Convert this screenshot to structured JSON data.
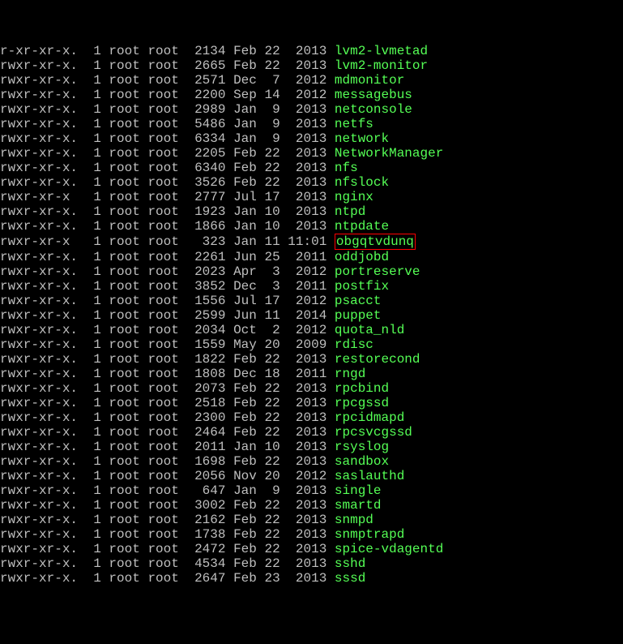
{
  "rows": [
    {
      "perms": "r-xr-xr-x.",
      "links": "1",
      "owner": "root",
      "group": "root",
      "size": "2134",
      "month": "Feb",
      "day": "22",
      "year": "2013",
      "name": "lvm2-lvmetad",
      "hl": false
    },
    {
      "perms": "rwxr-xr-x.",
      "links": "1",
      "owner": "root",
      "group": "root",
      "size": "2665",
      "month": "Feb",
      "day": "22",
      "year": "2013",
      "name": "lvm2-monitor",
      "hl": false
    },
    {
      "perms": "rwxr-xr-x.",
      "links": "1",
      "owner": "root",
      "group": "root",
      "size": "2571",
      "month": "Dec",
      "day": "7",
      "year": "2012",
      "name": "mdmonitor",
      "hl": false
    },
    {
      "perms": "rwxr-xr-x.",
      "links": "1",
      "owner": "root",
      "group": "root",
      "size": "2200",
      "month": "Sep",
      "day": "14",
      "year": "2012",
      "name": "messagebus",
      "hl": false
    },
    {
      "perms": "rwxr-xr-x.",
      "links": "1",
      "owner": "root",
      "group": "root",
      "size": "2989",
      "month": "Jan",
      "day": "9",
      "year": "2013",
      "name": "netconsole",
      "hl": false
    },
    {
      "perms": "rwxr-xr-x.",
      "links": "1",
      "owner": "root",
      "group": "root",
      "size": "5486",
      "month": "Jan",
      "day": "9",
      "year": "2013",
      "name": "netfs",
      "hl": false
    },
    {
      "perms": "rwxr-xr-x.",
      "links": "1",
      "owner": "root",
      "group": "root",
      "size": "6334",
      "month": "Jan",
      "day": "9",
      "year": "2013",
      "name": "network",
      "hl": false
    },
    {
      "perms": "rwxr-xr-x.",
      "links": "1",
      "owner": "root",
      "group": "root",
      "size": "2205",
      "month": "Feb",
      "day": "22",
      "year": "2013",
      "name": "NetworkManager",
      "hl": false
    },
    {
      "perms": "rwxr-xr-x.",
      "links": "1",
      "owner": "root",
      "group": "root",
      "size": "6340",
      "month": "Feb",
      "day": "22",
      "year": "2013",
      "name": "nfs",
      "hl": false
    },
    {
      "perms": "rwxr-xr-x.",
      "links": "1",
      "owner": "root",
      "group": "root",
      "size": "3526",
      "month": "Feb",
      "day": "22",
      "year": "2013",
      "name": "nfslock",
      "hl": false
    },
    {
      "perms": "rwxr-xr-x",
      "links": "1",
      "owner": "root",
      "group": "root",
      "size": "2777",
      "month": "Jul",
      "day": "17",
      "year": "2013",
      "name": "nginx",
      "hl": false
    },
    {
      "perms": "rwxr-xr-x.",
      "links": "1",
      "owner": "root",
      "group": "root",
      "size": "1923",
      "month": "Jan",
      "day": "10",
      "year": "2013",
      "name": "ntpd",
      "hl": false
    },
    {
      "perms": "rwxr-xr-x.",
      "links": "1",
      "owner": "root",
      "group": "root",
      "size": "1866",
      "month": "Jan",
      "day": "10",
      "year": "2013",
      "name": "ntpdate",
      "hl": false
    },
    {
      "perms": "rwxr-xr-x",
      "links": "1",
      "owner": "root",
      "group": "root",
      "size": "323",
      "month": "Jan",
      "day": "11",
      "year": "11:01",
      "name": "obgqtvdunq",
      "hl": true
    },
    {
      "perms": "rwxr-xr-x.",
      "links": "1",
      "owner": "root",
      "group": "root",
      "size": "2261",
      "month": "Jun",
      "day": "25",
      "year": "2011",
      "name": "oddjobd",
      "hl": false
    },
    {
      "perms": "rwxr-xr-x.",
      "links": "1",
      "owner": "root",
      "group": "root",
      "size": "2023",
      "month": "Apr",
      "day": "3",
      "year": "2012",
      "name": "portreserve",
      "hl": false
    },
    {
      "perms": "rwxr-xr-x.",
      "links": "1",
      "owner": "root",
      "group": "root",
      "size": "3852",
      "month": "Dec",
      "day": "3",
      "year": "2011",
      "name": "postfix",
      "hl": false
    },
    {
      "perms": "rwxr-xr-x.",
      "links": "1",
      "owner": "root",
      "group": "root",
      "size": "1556",
      "month": "Jul",
      "day": "17",
      "year": "2012",
      "name": "psacct",
      "hl": false
    },
    {
      "perms": "rwxr-xr-x.",
      "links": "1",
      "owner": "root",
      "group": "root",
      "size": "2599",
      "month": "Jun",
      "day": "11",
      "year": "2014",
      "name": "puppet",
      "hl": false
    },
    {
      "perms": "rwxr-xr-x.",
      "links": "1",
      "owner": "root",
      "group": "root",
      "size": "2034",
      "month": "Oct",
      "day": "2",
      "year": "2012",
      "name": "quota_nld",
      "hl": false
    },
    {
      "perms": "rwxr-xr-x.",
      "links": "1",
      "owner": "root",
      "group": "root",
      "size": "1559",
      "month": "May",
      "day": "20",
      "year": "2009",
      "name": "rdisc",
      "hl": false
    },
    {
      "perms": "rwxr-xr-x.",
      "links": "1",
      "owner": "root",
      "group": "root",
      "size": "1822",
      "month": "Feb",
      "day": "22",
      "year": "2013",
      "name": "restorecond",
      "hl": false
    },
    {
      "perms": "rwxr-xr-x.",
      "links": "1",
      "owner": "root",
      "group": "root",
      "size": "1808",
      "month": "Dec",
      "day": "18",
      "year": "2011",
      "name": "rngd",
      "hl": false
    },
    {
      "perms": "rwxr-xr-x.",
      "links": "1",
      "owner": "root",
      "group": "root",
      "size": "2073",
      "month": "Feb",
      "day": "22",
      "year": "2013",
      "name": "rpcbind",
      "hl": false
    },
    {
      "perms": "rwxr-xr-x.",
      "links": "1",
      "owner": "root",
      "group": "root",
      "size": "2518",
      "month": "Feb",
      "day": "22",
      "year": "2013",
      "name": "rpcgssd",
      "hl": false
    },
    {
      "perms": "rwxr-xr-x.",
      "links": "1",
      "owner": "root",
      "group": "root",
      "size": "2300",
      "month": "Feb",
      "day": "22",
      "year": "2013",
      "name": "rpcidmapd",
      "hl": false
    },
    {
      "perms": "rwxr-xr-x.",
      "links": "1",
      "owner": "root",
      "group": "root",
      "size": "2464",
      "month": "Feb",
      "day": "22",
      "year": "2013",
      "name": "rpcsvcgssd",
      "hl": false
    },
    {
      "perms": "rwxr-xr-x.",
      "links": "1",
      "owner": "root",
      "group": "root",
      "size": "2011",
      "month": "Jan",
      "day": "10",
      "year": "2013",
      "name": "rsyslog",
      "hl": false
    },
    {
      "perms": "rwxr-xr-x.",
      "links": "1",
      "owner": "root",
      "group": "root",
      "size": "1698",
      "month": "Feb",
      "day": "22",
      "year": "2013",
      "name": "sandbox",
      "hl": false
    },
    {
      "perms": "rwxr-xr-x.",
      "links": "1",
      "owner": "root",
      "group": "root",
      "size": "2056",
      "month": "Nov",
      "day": "20",
      "year": "2012",
      "name": "saslauthd",
      "hl": false
    },
    {
      "perms": "rwxr-xr-x.",
      "links": "1",
      "owner": "root",
      "group": "root",
      "size": "647",
      "month": "Jan",
      "day": "9",
      "year": "2013",
      "name": "single",
      "hl": false
    },
    {
      "perms": "rwxr-xr-x.",
      "links": "1",
      "owner": "root",
      "group": "root",
      "size": "3002",
      "month": "Feb",
      "day": "22",
      "year": "2013",
      "name": "smartd",
      "hl": false
    },
    {
      "perms": "rwxr-xr-x.",
      "links": "1",
      "owner": "root",
      "group": "root",
      "size": "2162",
      "month": "Feb",
      "day": "22",
      "year": "2013",
      "name": "snmpd",
      "hl": false
    },
    {
      "perms": "rwxr-xr-x.",
      "links": "1",
      "owner": "root",
      "group": "root",
      "size": "1738",
      "month": "Feb",
      "day": "22",
      "year": "2013",
      "name": "snmptrapd",
      "hl": false
    },
    {
      "perms": "rwxr-xr-x.",
      "links": "1",
      "owner": "root",
      "group": "root",
      "size": "2472",
      "month": "Feb",
      "day": "22",
      "year": "2013",
      "name": "spice-vdagentd",
      "hl": false
    },
    {
      "perms": "rwxr-xr-x.",
      "links": "1",
      "owner": "root",
      "group": "root",
      "size": "4534",
      "month": "Feb",
      "day": "22",
      "year": "2013",
      "name": "sshd",
      "hl": false
    },
    {
      "perms": "rwxr-xr-x.",
      "links": "1",
      "owner": "root",
      "group": "root",
      "size": "2647",
      "month": "Feb",
      "day": "23",
      "year": "2013",
      "name": "sssd",
      "hl": false
    }
  ]
}
